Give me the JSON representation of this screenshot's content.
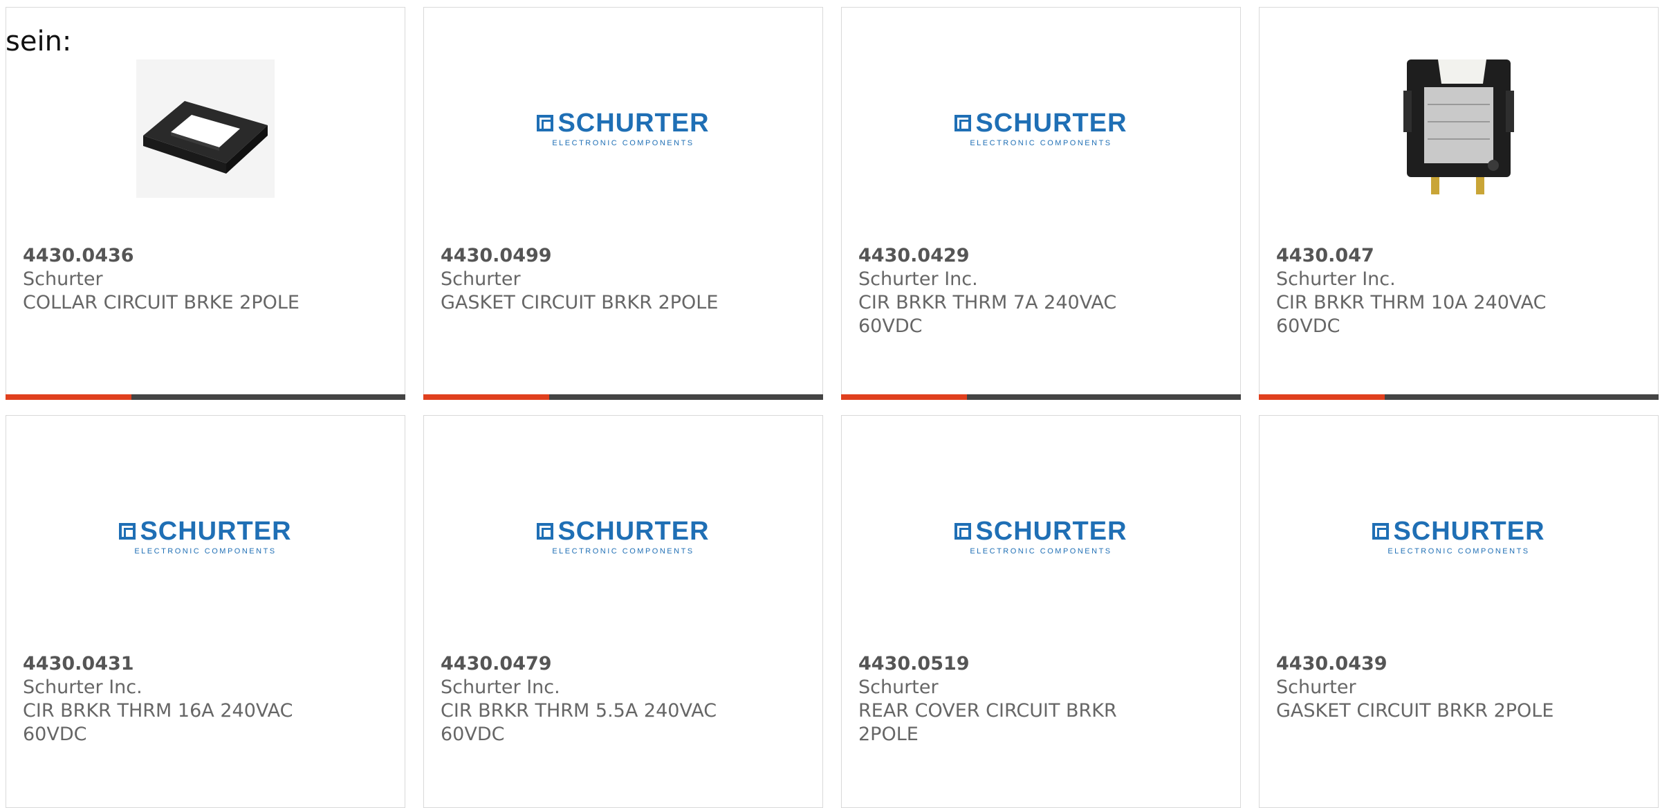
{
  "intro_text": "sein:",
  "brand": {
    "wordmark": "SCHURTER",
    "tagline": "ELECTRONIC COMPONENTS",
    "color": "#1f6fb5"
  },
  "colors": {
    "accent": "#e0401e",
    "bar": "#444444",
    "border": "#d9d9d9",
    "text": "#666666"
  },
  "products": [
    {
      "part": "4430.0436",
      "maker": "Schurter",
      "desc": "COLLAR CIRCUIT BRKE 2POLE",
      "image": "collar-photo"
    },
    {
      "part": "4430.0499",
      "maker": "Schurter",
      "desc": "GASKET CIRCUIT BRKR 2POLE",
      "image": "logo"
    },
    {
      "part": "4430.0429",
      "maker": "Schurter Inc.",
      "desc": "CIR BRKR THRM 7A 240VAC 60VDC",
      "image": "logo"
    },
    {
      "part": "4430.047",
      "maker": "Schurter Inc.",
      "desc": "CIR BRKR THRM 10A 240VAC 60VDC",
      "image": "breaker-photo"
    },
    {
      "part": "4430.0431",
      "maker": "Schurter Inc.",
      "desc": "CIR BRKR THRM 16A 240VAC 60VDC",
      "image": "logo"
    },
    {
      "part": "4430.0479",
      "maker": "Schurter Inc.",
      "desc": "CIR BRKR THRM 5.5A 240VAC 60VDC",
      "image": "logo"
    },
    {
      "part": "4430.0519",
      "maker": "Schurter",
      "desc": "REAR COVER CIRCUIT BRKR 2POLE",
      "image": "logo"
    },
    {
      "part": "4430.0439",
      "maker": "Schurter",
      "desc": "GASKET CIRCUIT BRKR 2POLE",
      "image": "logo"
    }
  ]
}
